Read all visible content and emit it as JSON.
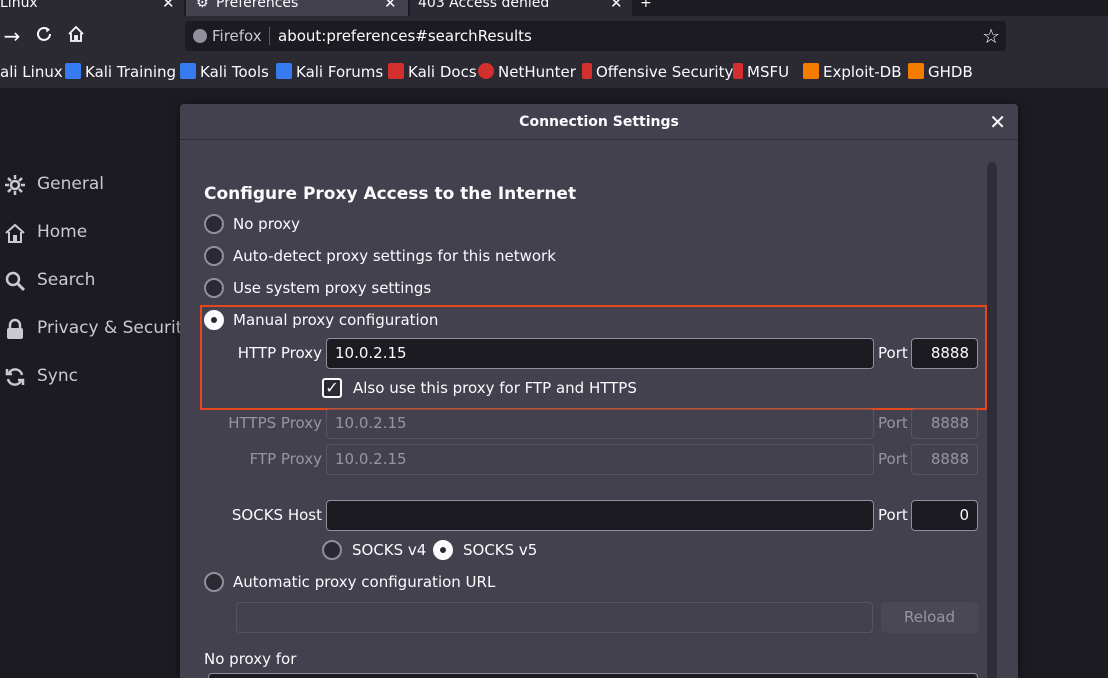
{
  "tabs": [
    {
      "label": "Linux",
      "close": "✕"
    },
    {
      "label": "Preferences",
      "close": "✕"
    },
    {
      "label": "403 Access denied",
      "close": "✕"
    }
  ],
  "new_tab": "+",
  "urlbar": {
    "identity": "Firefox",
    "url": "about:preferences#searchResults"
  },
  "bookmarks": [
    {
      "label": "ali Linux",
      "icon_color": "#367bf0"
    },
    {
      "label": "Kali Training",
      "icon_color": "#367bf0"
    },
    {
      "label": "Kali Tools",
      "icon_color": "#367bf0"
    },
    {
      "label": "Kali Forums",
      "icon_color": "#367bf0"
    },
    {
      "label": "Kali Docs",
      "icon_color": "#d32f2f"
    },
    {
      "label": "NetHunter",
      "icon_color": "#d32f2f"
    },
    {
      "label": "Offensive Security",
      "icon_color": "#d32f2f"
    },
    {
      "label": "MSFU",
      "icon_color": "#d32f2f"
    },
    {
      "label": "Exploit-DB",
      "icon_color": "#f57c00"
    },
    {
      "label": "GHDB",
      "icon_color": "#f57c00"
    }
  ],
  "sidebar": {
    "items": [
      {
        "label": "General",
        "icon": "gear-icon"
      },
      {
        "label": "Home",
        "icon": "home-icon"
      },
      {
        "label": "Search",
        "icon": "search-icon"
      },
      {
        "label": "Privacy & Security",
        "icon": "lock-icon"
      },
      {
        "label": "Sync",
        "icon": "sync-icon"
      }
    ]
  },
  "dialog": {
    "title": "Connection Settings",
    "close": "✕",
    "heading": "Configure Proxy Access to the Internet",
    "options": {
      "no_proxy": "No proxy",
      "auto_detect": "Auto-detect proxy settings for this network",
      "system": "Use system proxy settings",
      "manual": "Manual proxy configuration",
      "auto_url": "Automatic proxy configuration URL"
    },
    "selected_option": "manual",
    "http": {
      "label": "HTTP Proxy",
      "value": "10.0.2.15",
      "port_label": "Port",
      "port": "8888"
    },
    "also_use": {
      "label": "Also use this proxy for FTP and HTTPS",
      "checked": true
    },
    "https": {
      "label": "HTTPS Proxy",
      "value": "10.0.2.15",
      "port_label": "Port",
      "port": "8888"
    },
    "ftp": {
      "label": "FTP Proxy",
      "value": "10.0.2.15",
      "port_label": "Port",
      "port": "8888"
    },
    "socks": {
      "label": "SOCKS Host",
      "value": "",
      "port_label": "Port",
      "port": "0",
      "v4": "SOCKS v4",
      "v5": "SOCKS v5",
      "selected": "v5"
    },
    "auto_url_value": "",
    "reload": "Reload",
    "no_proxy_for": "No proxy for"
  },
  "colors": {
    "accent": "#0060df",
    "highlight_border": "#e8471d"
  }
}
